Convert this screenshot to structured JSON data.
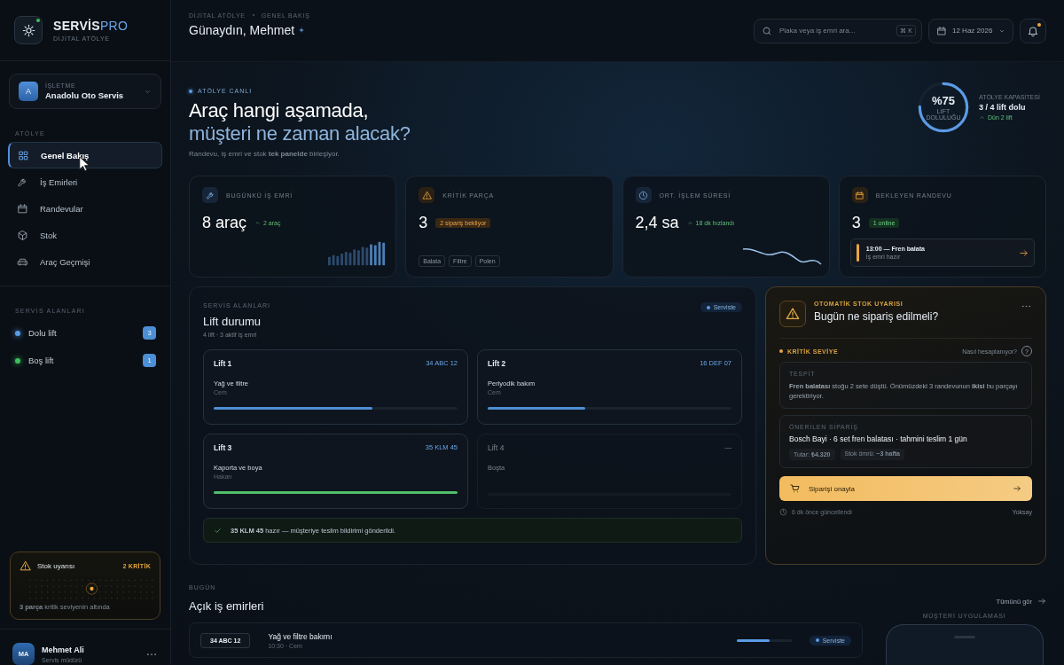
{
  "brand": {
    "name": "SERVİS",
    "accent": "PRO",
    "tagline": "DİJİTAL ATÖLYE"
  },
  "business": {
    "label": "İŞLETME",
    "initial": "A",
    "name": "Anadolu Oto Servis"
  },
  "nav_section": "ATÖLYE",
  "nav": [
    {
      "label": "Genel Bakış",
      "selected": true
    },
    {
      "label": "İş Emirleri",
      "selected": false
    },
    {
      "label": "Randevular",
      "selected": false
    },
    {
      "label": "Stok",
      "selected": false
    },
    {
      "label": "Araç Geçmişi",
      "selected": false
    }
  ],
  "areas_section": "SERVİS ALANLARI",
  "areas": [
    {
      "label": "Dolu lift",
      "count": "3",
      "color": "#5b9be6"
    },
    {
      "label": "Boş lift",
      "count": "1",
      "color": "#3fbf5f"
    }
  ],
  "stock_alert": {
    "title": "Stok uyarısı",
    "badge": "2 KRİTİK",
    "text": "**3 parça** kritik seviyenin altında"
  },
  "user": {
    "initials": "MA",
    "name": "Mehmet Ali",
    "role": "Servis müdürü"
  },
  "breadcrumb": [
    "DİJİTAL ATÖLYE",
    "GENEL BAKIŞ"
  ],
  "greeting": "Günaydın, Mehmet",
  "search": {
    "placeholder": "Plaka veya iş emri ara...",
    "shortcut": "⌘ K"
  },
  "date": "12 Haz 2026",
  "notifications": {
    "unread": true
  },
  "hero": {
    "live": "ATÖLYE CANLI",
    "title_1": "Araç hangi aşamada,",
    "title_2": "müşteri ne zaman alacak?",
    "subtitle": "Randevu, iş emri ve stok **tek panelde** birleşiyor."
  },
  "capacity": {
    "percent": "%75",
    "ring_label": "LİFT DOLULUĞU",
    "label": "ATÖLYE KAPASİTESİ",
    "value": "3 / 4 lift dolu",
    "delta": "Dün 2 lift"
  },
  "stats": [
    {
      "kind": "bars",
      "label": "BUGÜNKÜ İŞ EMRİ",
      "value": "8 araç",
      "delta": "2 araç"
    },
    {
      "kind": "tags",
      "label": "KRİTİK PARÇA",
      "value": "3",
      "badge": "2 sipariş bekliyor",
      "tags": [
        "Balata",
        "Filtre",
        "Polen"
      ]
    },
    {
      "kind": "wave",
      "label": "ORT. İŞLEM SÜRESİ",
      "value": "2,4 sa",
      "delta": "18 dk hızlandı"
    },
    {
      "kind": "appointment",
      "label": "BEKLEYEN RANDEVU",
      "value": "3",
      "badge": "1 online",
      "next": {
        "title": "13:00 — Fren balata",
        "sub": "İş emri hazır"
      }
    }
  ],
  "lifts_panel": {
    "eyebrow": "SERVİS ALANLARI",
    "title": "Lift durumu",
    "subtitle": "4 lift · 3 aktif iş emri",
    "badge": "Serviste",
    "lifts": [
      {
        "kind": "active",
        "name": "Lift 1",
        "plate": "34 ABC 12",
        "job": "Yağ ve filtre",
        "tech": "Cem",
        "level": 0.65
      },
      {
        "kind": "active",
        "name": "Lift 2",
        "plate": "16 DEF 07",
        "job": "Periyodik bakım",
        "tech": "Cem",
        "level": 0.4
      },
      {
        "kind": "done",
        "name": "Lift 3",
        "plate": "35 KLM 45",
        "job": "Kaporta ve boya",
        "tech": "Hakan",
        "level": 1
      },
      {
        "kind": "idle",
        "name": "Lift 4",
        "plate": "—",
        "job": "Boşta"
      }
    ],
    "notice": "**35 KLM 45** hazır — müşteriye teslim bildirimi gönderildi."
  },
  "order_panel": {
    "eyebrow": "OTOMATİK STOK UYARISI",
    "title": "Bugün ne sipariş edilmeli?",
    "level_label": "KRİTİK SEVİYE",
    "help": "Nasıl hesaplanıyor?",
    "help_icon": "?",
    "finding_label": "TESPİT",
    "finding": "**Fren balatası** stoğu 2 sete düştü. Önümüzdeki 3 randevunun **ikisi** bu parçayı gerektiriyor.",
    "suggestion_label": "ÖNERİLEN SİPARİŞ",
    "suggestion": "Bosch Bayi · 6 set fren balatası · tahmini teslim 1 gün",
    "chips": [
      "Tutar: **₺4.320**",
      "Stok ömrü: **~3 hafta**"
    ],
    "action": "Siparişi onayla",
    "updated": "6 dk önce güncellendi",
    "dismiss": "Yoksay"
  },
  "orders": {
    "eyebrow": "BUGÜN",
    "title": "Açık iş emirleri",
    "see_all": "Tümünü gör",
    "rows": [
      {
        "plate": "34 ABC 12",
        "title": "Yağ ve filtre bakımı",
        "meta": "10:30 · Cem",
        "level": 0.6,
        "status": "Serviste"
      }
    ]
  },
  "customer_app": {
    "label": "MÜŞTERİ UYGULAMASI"
  }
}
